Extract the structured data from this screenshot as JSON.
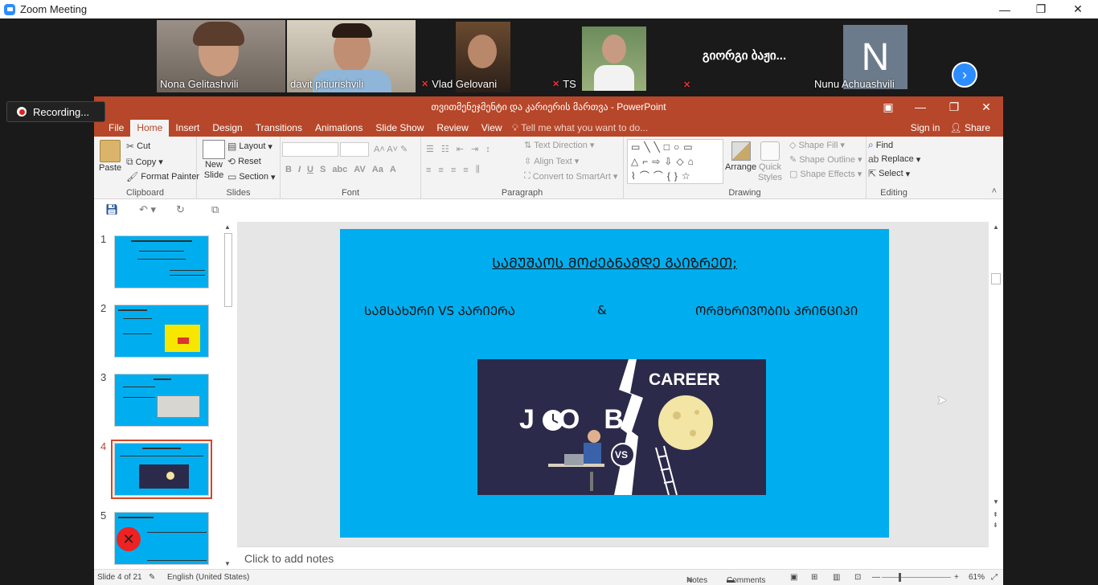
{
  "zoom": {
    "title": "Zoom Meeting",
    "controls": [
      "—",
      "❐",
      "✕"
    ],
    "recording_label": "Recording...",
    "participants": [
      {
        "name": "Nona Gelitashvili",
        "muted": false,
        "active": false
      },
      {
        "name": "davit pitiurishvili",
        "muted": false,
        "active": true
      },
      {
        "name": "Vlad Gelovani",
        "muted": true,
        "active": false
      },
      {
        "name": "TS",
        "muted": true,
        "active": false
      },
      {
        "name": "გიორგი ბაჟი...",
        "muted": true,
        "active": false,
        "video_off": true
      },
      {
        "name": "Nunu Achuashvili",
        "muted": false,
        "active": false,
        "avatar_letter": "N"
      }
    ],
    "next_icon": "chevron-right"
  },
  "ppt": {
    "window_title": "თვითმენეჯმენტი და კარიერის მართვა - PowerPoint",
    "tabs": [
      "File",
      "Home",
      "Insert",
      "Design",
      "Transitions",
      "Animations",
      "Slide Show",
      "Review",
      "View"
    ],
    "selected_tab": "Home",
    "tell_me": "Tell me what you want to do...",
    "sign_in": "Sign in",
    "share": "Share",
    "ribbon": {
      "clipboard": {
        "label": "Clipboard",
        "paste": "Paste",
        "cut": "Cut",
        "copy": "Copy",
        "format_painter": "Format Painter"
      },
      "slides": {
        "label": "Slides",
        "new_slide": "New Slide",
        "layout": "Layout",
        "reset": "Reset",
        "section": "Section"
      },
      "font": {
        "label": "Font"
      },
      "paragraph": {
        "label": "Paragraph",
        "text_direction": "Text Direction",
        "align_text": "Align Text",
        "convert": "Convert to SmartArt"
      },
      "drawing": {
        "label": "Drawing",
        "arrange": "Arrange",
        "quick_styles": "Quick Styles",
        "shape_fill": "Shape Fill",
        "shape_outline": "Shape Outline",
        "shape_effects": "Shape Effects"
      },
      "editing": {
        "label": "Editing",
        "find": "Find",
        "replace": "Replace",
        "select": "Select"
      }
    },
    "thumbnails": [
      {
        "num": "1",
        "current": false
      },
      {
        "num": "2",
        "current": false
      },
      {
        "num": "3",
        "current": false
      },
      {
        "num": "4",
        "current": true
      },
      {
        "num": "5",
        "current": false
      }
    ],
    "slide": {
      "title": "ᲡᲐᲛᲣᲨᲐᲝᲡ ᲛᲝᲫᲔᲑᲜᲐᲛᲓᲔ ᲒᲐᲘᲖᲠᲔᲗ;",
      "left_text": "ᲡᲐᲛᲡᲐᲮᲣᲠᲘ VS ᲙᲐᲠᲘᲔᲠᲐ",
      "amp": "&",
      "right_text": "ᲝᲠᲛᲮᲠᲘᲕᲝᲑᲘᲡ ᲞᲠᲘᲜᲪᲘᲞᲘ",
      "img_career": "CAREER",
      "img_job": "JOB",
      "img_vs": "VS",
      "bg_color": "#00aeef"
    },
    "notes_placeholder": "Click to add notes",
    "status": {
      "slide_info": "Slide 4 of 21",
      "language": "English (United States)",
      "notes": "Notes",
      "comments": "Comments",
      "zoom": "61%"
    }
  }
}
